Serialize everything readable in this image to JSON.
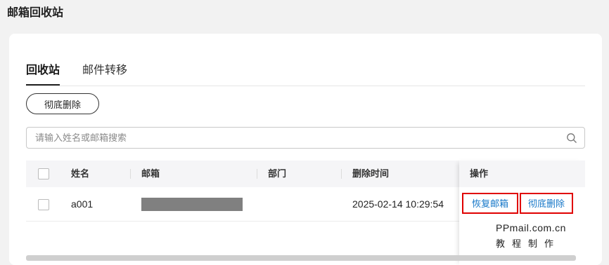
{
  "page": {
    "title": "邮箱回收站"
  },
  "tabs": [
    {
      "label": "回收站",
      "active": true
    },
    {
      "label": "邮件转移",
      "active": false
    }
  ],
  "toolbar": {
    "purge_label": "彻底删除"
  },
  "search": {
    "placeholder": "请输入姓名或邮箱搜索",
    "value": "",
    "icon": "search-icon"
  },
  "table": {
    "columns": [
      "姓名",
      "邮箱",
      "部门",
      "删除时间",
      "操作"
    ],
    "rows": [
      {
        "name": "a001",
        "email": "",
        "department": "",
        "deleted_at": "2025-02-14 10:29:54",
        "actions": [
          "恢复邮箱",
          "彻底删除"
        ]
      }
    ]
  },
  "watermark": {
    "line1": "PPmail.com.cn",
    "line2": "教程制作"
  },
  "colors": {
    "link": "#1677c8",
    "highlight_border": "#e00000",
    "header_bg": "#f5f5f7"
  }
}
